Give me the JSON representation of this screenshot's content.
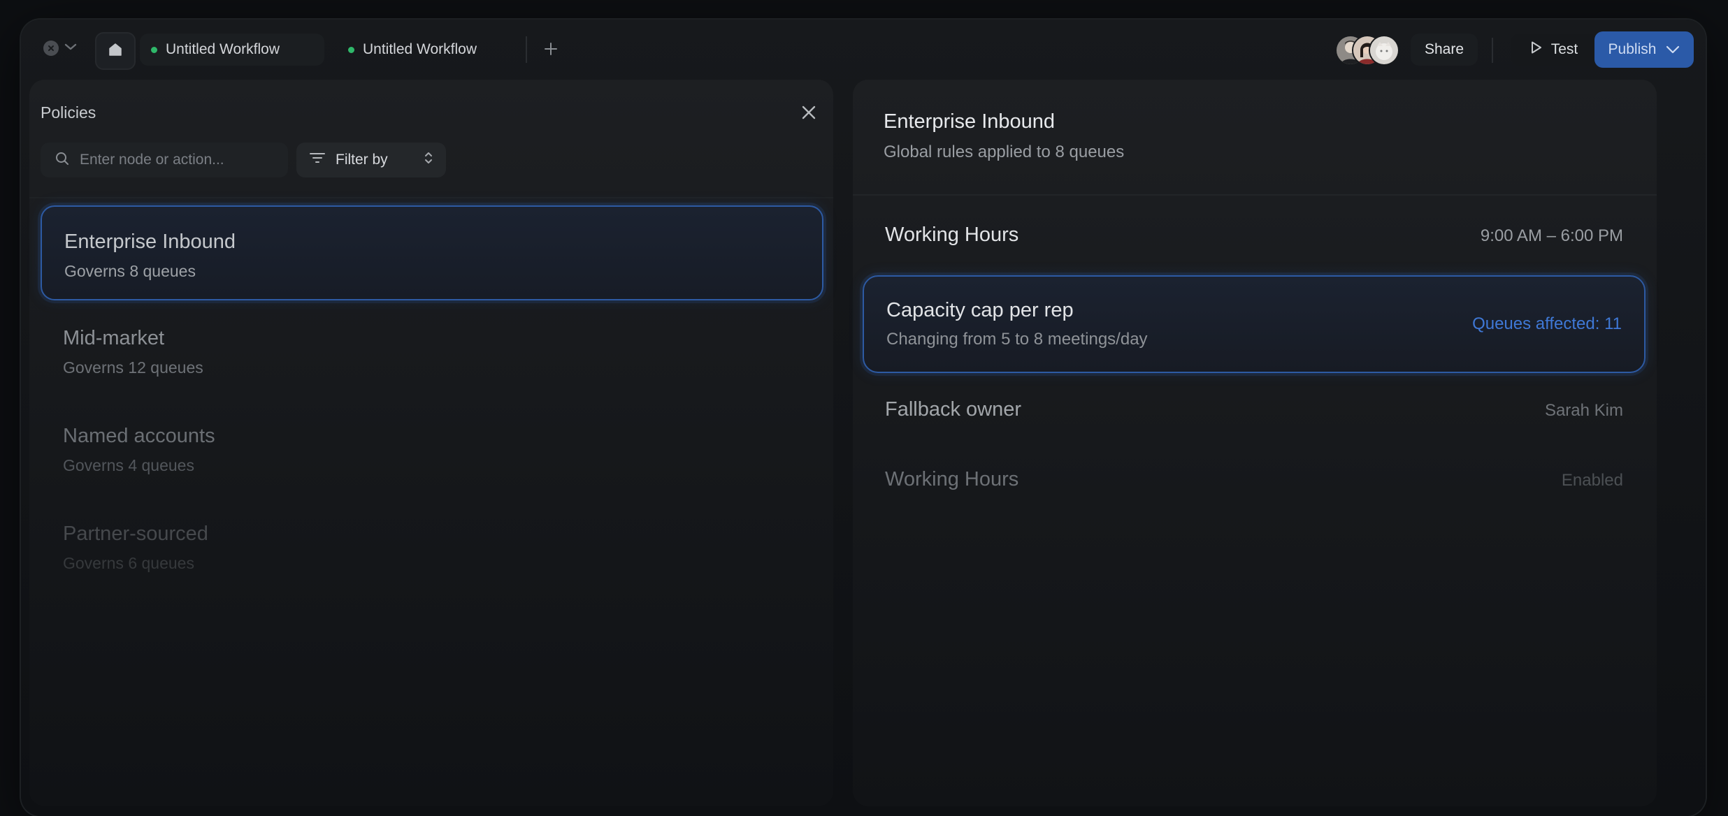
{
  "tabs": [
    {
      "label": "Untitled Workflow"
    },
    {
      "label": "Untitled Workflow"
    }
  ],
  "toolbar": {
    "share_label": "Share",
    "test_label": "Test",
    "publish_label": "Publish"
  },
  "left": {
    "title": "Policies",
    "search_placeholder": "Enter node or action...",
    "filter_label": "Filter by",
    "policies": [
      {
        "name": "Enterprise Inbound",
        "sub": "Governs 8 queues"
      },
      {
        "name": "Mid-market",
        "sub": "Governs 12 queues"
      },
      {
        "name": "Named accounts",
        "sub": "Governs 4 queues"
      },
      {
        "name": "Partner-sourced",
        "sub": "Governs 6 queues"
      }
    ]
  },
  "right": {
    "title": "Enterprise Inbound",
    "subtitle": "Global rules applied to 8 queues",
    "rules": [
      {
        "name": "Working Hours",
        "value": "9:00 AM – 6:00 PM"
      },
      {
        "name": "Capacity cap per rep",
        "sub": "Changing from 5 to 8 meetings/day",
        "value": "Queues affected: 11"
      },
      {
        "name": "Fallback owner",
        "value": "Sarah Kim"
      },
      {
        "name": "Working Hours",
        "value": "Enabled"
      }
    ]
  },
  "colors": {
    "accent": "#2b5aa8",
    "accent_text": "#3f78d6",
    "status_dot": "#2fb86a"
  }
}
